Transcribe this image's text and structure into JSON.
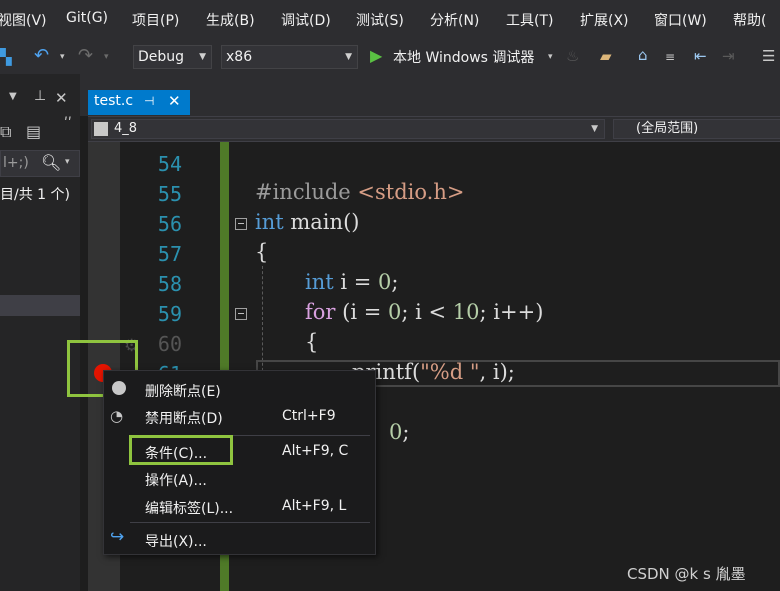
{
  "menubar": {
    "items": [
      "视图(V)",
      "Git(G)",
      "项目(P)",
      "生成(B)",
      "调试(D)",
      "测试(S)",
      "分析(N)",
      "工具(T)",
      "扩展(X)",
      "窗口(W)",
      "帮助("
    ]
  },
  "toolbar": {
    "config": "Debug",
    "platform": "x86",
    "run_label": "本地 Windows 调试器"
  },
  "left_panel": {
    "search_text": "l+;)",
    "count_text": "目/共 1 个)"
  },
  "editor": {
    "tab_title": "test.c",
    "nav_scope_left": "4_8",
    "nav_scope_right": "(全局范围)",
    "line_numbers": [
      "54",
      "55",
      "56",
      "57",
      "58",
      "59",
      "60",
      "61"
    ],
    "code": {
      "l55_pp": "#include",
      "l55_inc": "<stdio.h>",
      "l56_kw": "int",
      "l56_fn": "main",
      "l56_rest": "()",
      "l57": "{",
      "l58_kw": "int",
      "l58_a": " i = ",
      "l58_num": "0",
      "l58_b": ";",
      "l59_kw": "for",
      "l59_a": " (i = ",
      "l59_n1": "0",
      "l59_b": "; i < ",
      "l59_n2": "10",
      "l59_c": "; i++)",
      "l60": "{",
      "l61_fn": "printf",
      "l61_a": "(",
      "l61_str": "\"%d \"",
      "l61_b": ", i);",
      "l63_num": "0",
      "l63_b": ";"
    }
  },
  "context_menu": {
    "items": [
      {
        "label": "删除断点(E)",
        "shortcut": ""
      },
      {
        "label": "禁用断点(D)",
        "shortcut": "Ctrl+F9"
      },
      {
        "label": "条件(C)...",
        "shortcut": "Alt+F9, C"
      },
      {
        "label": "操作(A)...",
        "shortcut": ""
      },
      {
        "label": "编辑标签(L)...",
        "shortcut": "Alt+F9, L"
      },
      {
        "label": "导出(X)...",
        "shortcut": ""
      }
    ]
  },
  "watermark": "CSDN @k  s 胤墨",
  "colors": {
    "highlight_box": "#8fc43f",
    "accent": "#007acc",
    "breakpoint": "#e51400"
  }
}
